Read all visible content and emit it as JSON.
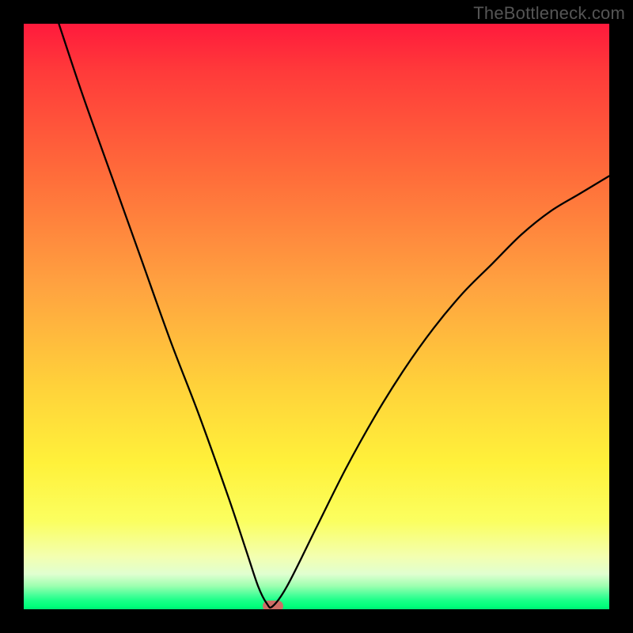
{
  "attribution": "TheBottleneck.com",
  "chart_data": {
    "type": "line",
    "title": "",
    "xlabel": "",
    "ylabel": "",
    "xlim": [
      0,
      100
    ],
    "ylim": [
      0,
      100
    ],
    "series": [
      {
        "name": "bottleneck-curve",
        "x": [
          6,
          10,
          15,
          20,
          25,
          30,
          35,
          38,
          40,
          41.5,
          42.5,
          45,
          50,
          55,
          60,
          65,
          70,
          75,
          80,
          85,
          90,
          95,
          100
        ],
        "y": [
          100,
          88,
          74,
          60,
          46,
          33,
          19,
          10,
          4,
          1,
          0.5,
          4,
          14,
          24,
          33,
          41,
          48,
          54,
          59,
          64,
          68,
          71,
          74
        ]
      }
    ],
    "marker": {
      "x": 42.5,
      "y": 0.5
    },
    "background": {
      "type": "vertical-gradient",
      "stops": [
        {
          "pos": 0,
          "color": "#ff1a3c",
          "meaning": "high-bottleneck"
        },
        {
          "pos": 50,
          "color": "#ffcc33",
          "meaning": "moderate"
        },
        {
          "pos": 100,
          "color": "#00e676",
          "meaning": "optimal"
        }
      ]
    }
  }
}
